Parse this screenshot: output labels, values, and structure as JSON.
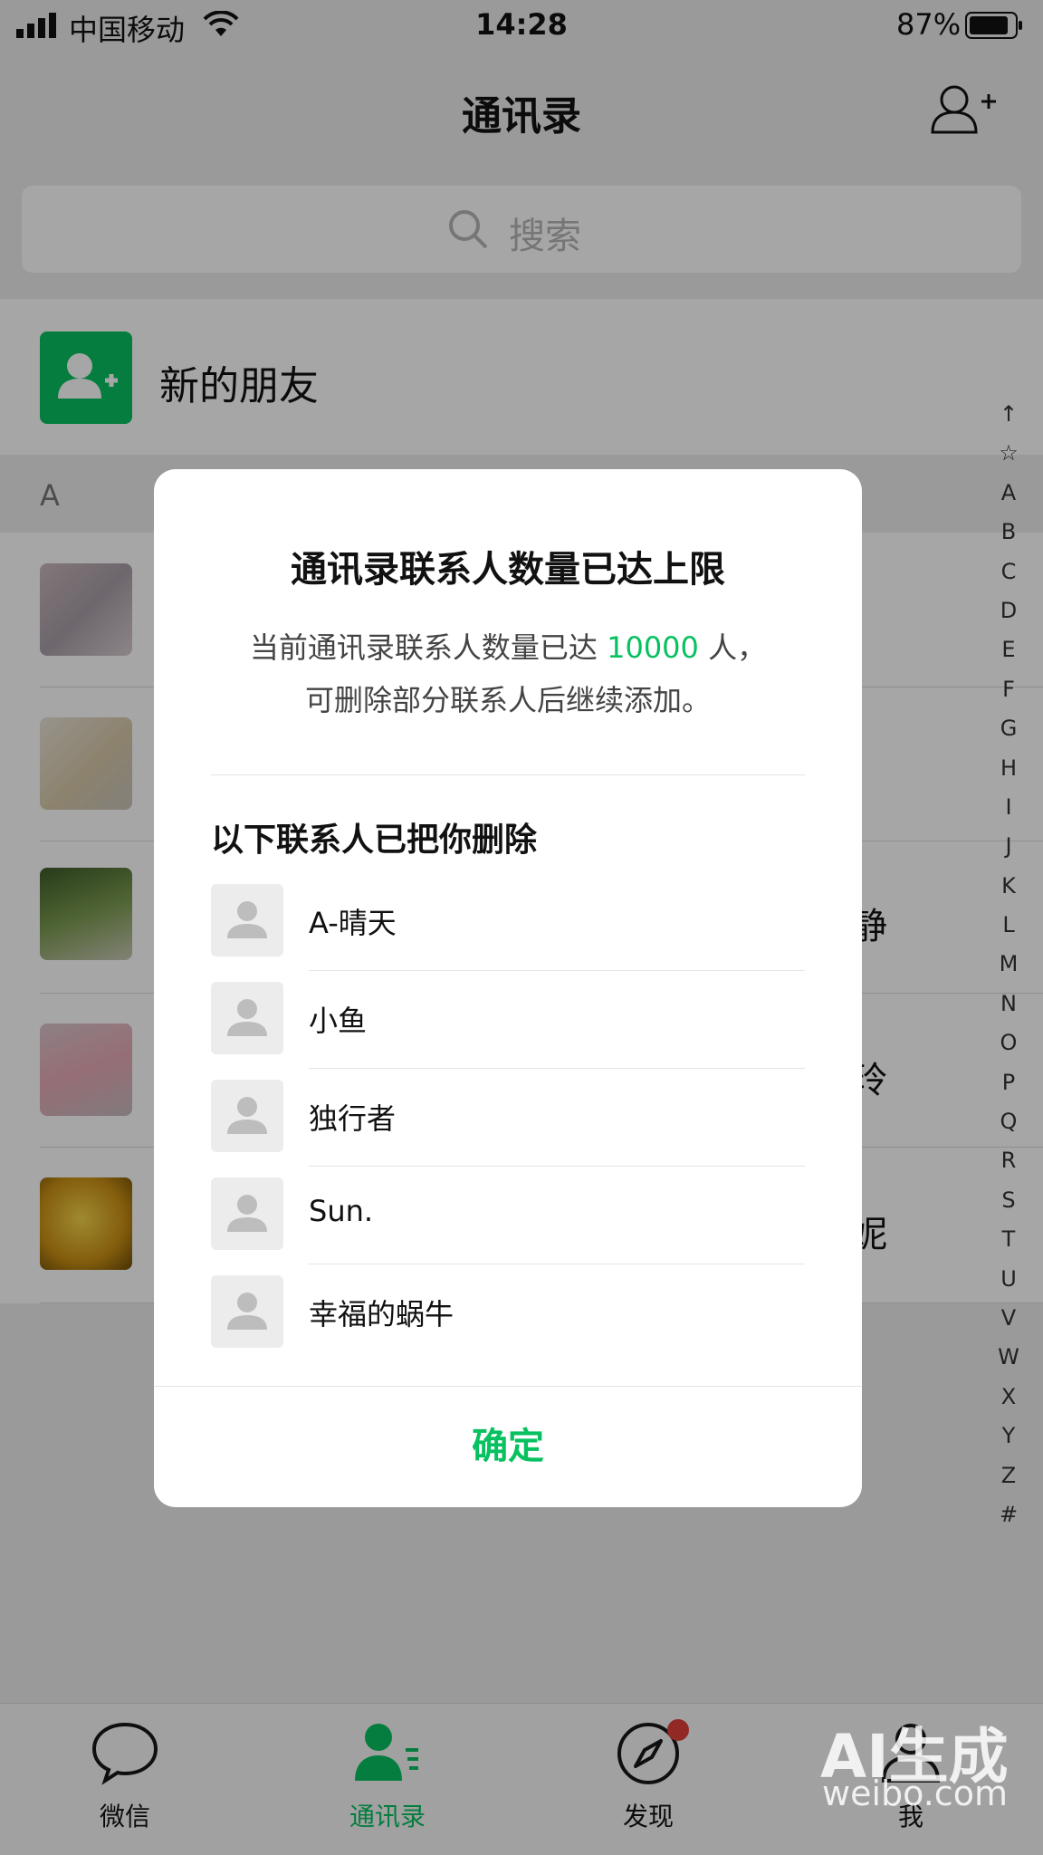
{
  "status_bar": {
    "carrier": "中国移动",
    "time": "14:28",
    "battery_percent": "87%"
  },
  "nav": {
    "title": "通讯录",
    "add_icon": "add-contact-icon"
  },
  "search": {
    "placeholder": "搜索",
    "icon": "search-icon"
  },
  "new_friends": {
    "label": "新的朋友",
    "icon": "new-friend-icon"
  },
  "list": {
    "section_letter": "A",
    "visible_name_fragments": [
      "静",
      "玲",
      "妮"
    ]
  },
  "index_bar": [
    "↑",
    "☆",
    "A",
    "B",
    "C",
    "D",
    "E",
    "F",
    "G",
    "H",
    "I",
    "J",
    "K",
    "L",
    "M",
    "N",
    "O",
    "P",
    "Q",
    "R",
    "S",
    "T",
    "U",
    "V",
    "W",
    "X",
    "Y",
    "Z",
    "#"
  ],
  "tabs": [
    {
      "label": "微信",
      "icon": "chat-bubble-icon",
      "active": false
    },
    {
      "label": "通讯录",
      "icon": "contacts-icon",
      "active": true
    },
    {
      "label": "发现",
      "icon": "compass-icon",
      "active": false
    },
    {
      "label": "我",
      "icon": "person-icon",
      "active": false
    }
  ],
  "dialog": {
    "title": "通讯录联系人数量已达上限",
    "message_line1_prefix": "当前通讯录联系人数量已达 ",
    "message_count": "10000",
    "message_line1_suffix": " 人，",
    "message_line2": "可删除部分联系人后继续添加。",
    "deleted_heading": "以下联系人已把你删除",
    "deleted_contacts": [
      "A-晴天",
      "小鱼",
      "独行者",
      "Sun.",
      "幸福的蜗牛"
    ],
    "confirm_label": "确定"
  },
  "colors": {
    "accent_green": "#07c160",
    "badge_red": "#e0403a"
  },
  "watermark": {
    "line1": "AI生成",
    "line2": "weibo.com"
  }
}
